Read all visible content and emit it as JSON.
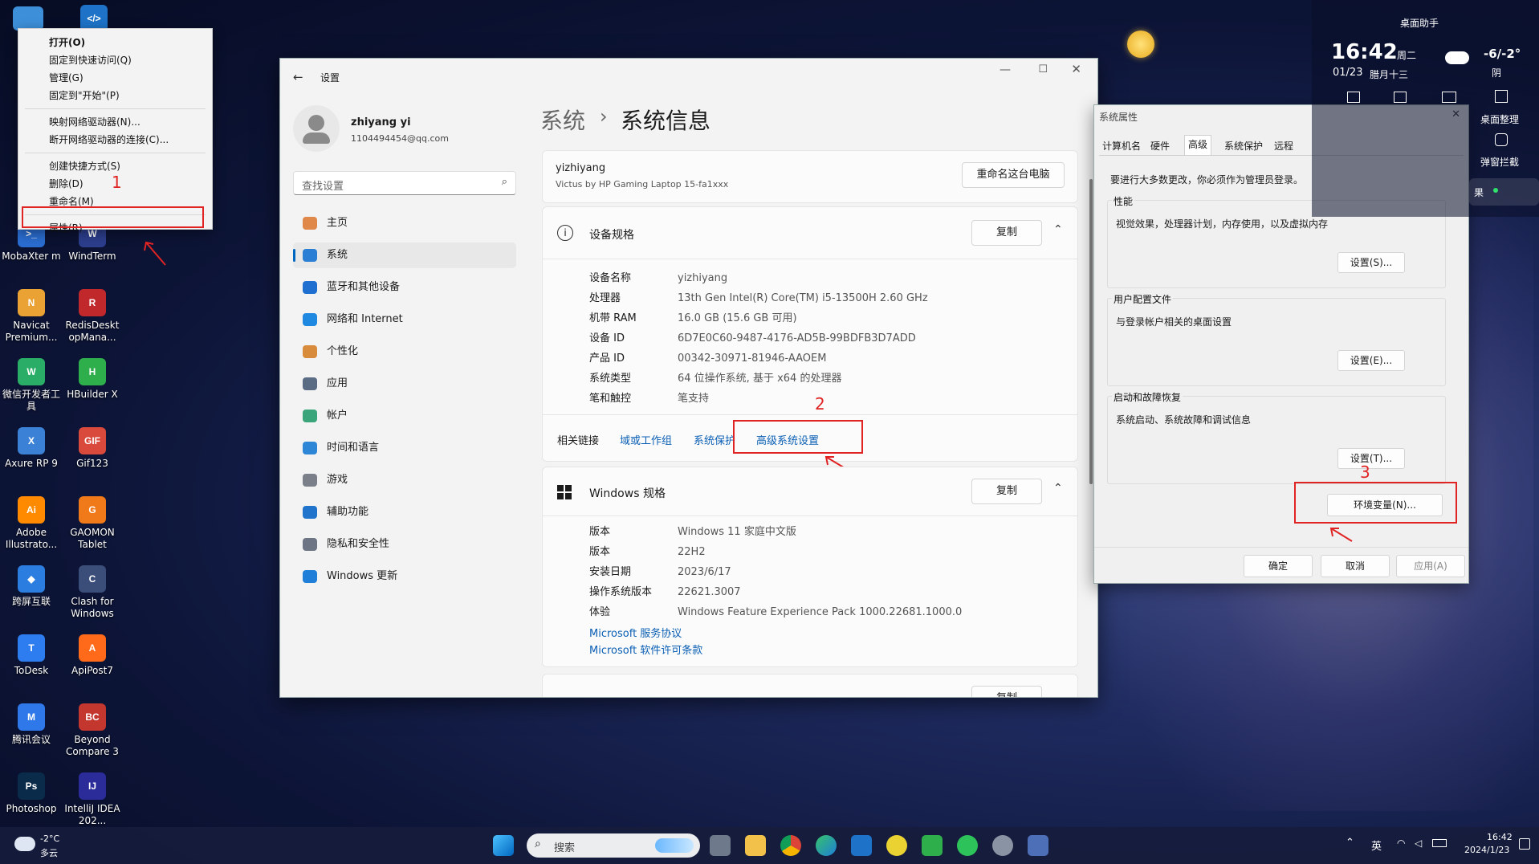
{
  "desktop": {
    "icons": [
      {
        "label": "MobaXter m",
        "glyph": ">_",
        "color": "#2a6ccf"
      },
      {
        "label": "WindTerm",
        "glyph": "W",
        "color": "#2c3e8c"
      },
      {
        "label": "Navicat Premium...",
        "glyph": "N",
        "color": "#e9a233"
      },
      {
        "label": "RedisDeskt opMana...",
        "glyph": "R",
        "color": "#c0282c"
      },
      {
        "label": "微信开发者工具",
        "glyph": "W",
        "color": "#2aae67"
      },
      {
        "label": "HBuilder X",
        "glyph": "H",
        "color": "#2fae4c"
      },
      {
        "label": "Axure RP 9",
        "glyph": "X",
        "color": "#3b82d6"
      },
      {
        "label": "Gif123",
        "glyph": "GIF",
        "color": "#d94a3c"
      },
      {
        "label": "Adobe Illustrato...",
        "glyph": "Ai",
        "color": "#ff8a00"
      },
      {
        "label": "GAOMON Tablet",
        "glyph": "G",
        "color": "#f07a1a"
      },
      {
        "label": "跨屏互联",
        "glyph": "◆",
        "color": "#2b7de0"
      },
      {
        "label": "Clash for Windows",
        "glyph": "C",
        "color": "#3b4d79"
      },
      {
        "label": "ToDesk",
        "glyph": "T",
        "color": "#2d7cf0"
      },
      {
        "label": "ApiPost7",
        "glyph": "A",
        "color": "#ff6a1a"
      },
      {
        "label": "腾讯会议",
        "glyph": "M",
        "color": "#2f78ea"
      },
      {
        "label": "Beyond Compare 3",
        "glyph": "BC",
        "color": "#c4372e"
      },
      {
        "label": "Photoshop",
        "glyph": "Ps",
        "color": "#0b2b4a"
      },
      {
        "label": "IntelliJ IDEA 202...",
        "glyph": "IJ",
        "color": "#2b2b9a"
      }
    ]
  },
  "context_menu": {
    "items_group1": [
      "打开(O)",
      "固定到快速访问(Q)",
      "管理(G)",
      "固定到\"开始\"(P)"
    ],
    "items_group2": [
      "映射网络驱动器(N)...",
      "断开网络驱动器的连接(C)..."
    ],
    "items_group3": [
      "创建快捷方式(S)",
      "删除(D)",
      "重命名(M)"
    ],
    "properties": "属性(R)",
    "annotation": "1"
  },
  "settings": {
    "title": "设置",
    "user": {
      "name": "zhiyang yi",
      "email": "1104494454@qq.com"
    },
    "search_placeholder": "查找设置",
    "nav": [
      {
        "label": "主页",
        "color": "#e0874a"
      },
      {
        "label": "系统",
        "color": "#2a7fd4"
      },
      {
        "label": "蓝牙和其他设备",
        "color": "#1f6fd0"
      },
      {
        "label": "网络和 Internet",
        "color": "#1f88e0"
      },
      {
        "label": "个性化",
        "color": "#d88b3b"
      },
      {
        "label": "应用",
        "color": "#5a6b84"
      },
      {
        "label": "帐户",
        "color": "#3aa57a"
      },
      {
        "label": "时间和语言",
        "color": "#2d86d6"
      },
      {
        "label": "游戏",
        "color": "#7a7f8a"
      },
      {
        "label": "辅助功能",
        "color": "#2074cc"
      },
      {
        "label": "隐私和安全性",
        "color": "#6d7584"
      },
      {
        "label": "Windows 更新",
        "color": "#1f7ed8"
      }
    ],
    "breadcrumb": {
      "parent": "系统",
      "sep": "›",
      "current": "系统信息"
    },
    "device_card": {
      "name": "yizhiyang",
      "model": "Victus by HP Gaming Laptop 15-fa1xxx",
      "rename_btn": "重命名这台电脑"
    },
    "device_spec": {
      "title": "设备规格",
      "copy": "复制",
      "rows": [
        {
          "k": "设备名称",
          "v": "yizhiyang"
        },
        {
          "k": "处理器",
          "v": "13th Gen Intel(R) Core(TM) i5-13500H   2.60 GHz"
        },
        {
          "k": "机带 RAM",
          "v": "16.0 GB (15.6 GB 可用)"
        },
        {
          "k": "设备 ID",
          "v": "6D7E0C60-9487-4176-AD5B-99BDFB3D7ADD"
        },
        {
          "k": "产品 ID",
          "v": "00342-30971-81946-AAOEM"
        },
        {
          "k": "系统类型",
          "v": "64 位操作系统, 基于 x64 的处理器"
        },
        {
          "k": "笔和触控",
          "v": "笔支持"
        }
      ]
    },
    "related": {
      "label": "相关链接",
      "links": [
        "域或工作组",
        "系统保护",
        "高级系统设置"
      ],
      "annotation": "2"
    },
    "windows_spec": {
      "title": "Windows 规格",
      "copy": "复制",
      "rows": [
        {
          "k": "版本",
          "v": "Windows 11 家庭中文版"
        },
        {
          "k": "版本",
          "v": "22H2"
        },
        {
          "k": "安装日期",
          "v": "2023/6/17"
        },
        {
          "k": "操作系统版本",
          "v": "22621.3007"
        },
        {
          "k": "体验",
          "v": "Windows Feature Experience Pack 1000.22681.1000.0"
        }
      ],
      "links": [
        "Microsoft 服务协议",
        "Microsoft 软件许可条款"
      ]
    },
    "next_section_copy": "复制"
  },
  "sysprops": {
    "title": "系统属性",
    "tabs": [
      "计算机名",
      "硬件",
      "高级",
      "系统保护",
      "远程"
    ],
    "admin_note": "要进行大多数更改，你必须作为管理员登录。",
    "perf": {
      "title": "性能",
      "desc": "视觉效果，处理器计划，内存使用，以及虚拟内存",
      "btn": "设置(S)..."
    },
    "profile": {
      "title": "用户配置文件",
      "desc": "与登录帐户相关的桌面设置",
      "btn": "设置(E)..."
    },
    "startup": {
      "title": "启动和故障恢复",
      "desc": "系统启动、系统故障和调试信息",
      "btn": "设置(T)..."
    },
    "env_btn": "环境变量(N)...",
    "annotation": "3",
    "ok": "确定",
    "cancel": "取消",
    "apply": "应用(A)"
  },
  "widget": {
    "title": "桌面助手",
    "time": "16:42",
    "weekday": "周二",
    "date": "01/23",
    "lunar": "腊月十三",
    "temp": "-6/-2°",
    "weather": "阴",
    "tools": [
      "桌面整理",
      "弹窗拦截"
    ],
    "side_label": "果"
  },
  "taskbar": {
    "weather_temp": "-2°C",
    "weather_desc": "多云",
    "search_placeholder": "搜索",
    "lang": "英",
    "clock_time": "16:42",
    "clock_date": "2024/1/23"
  }
}
